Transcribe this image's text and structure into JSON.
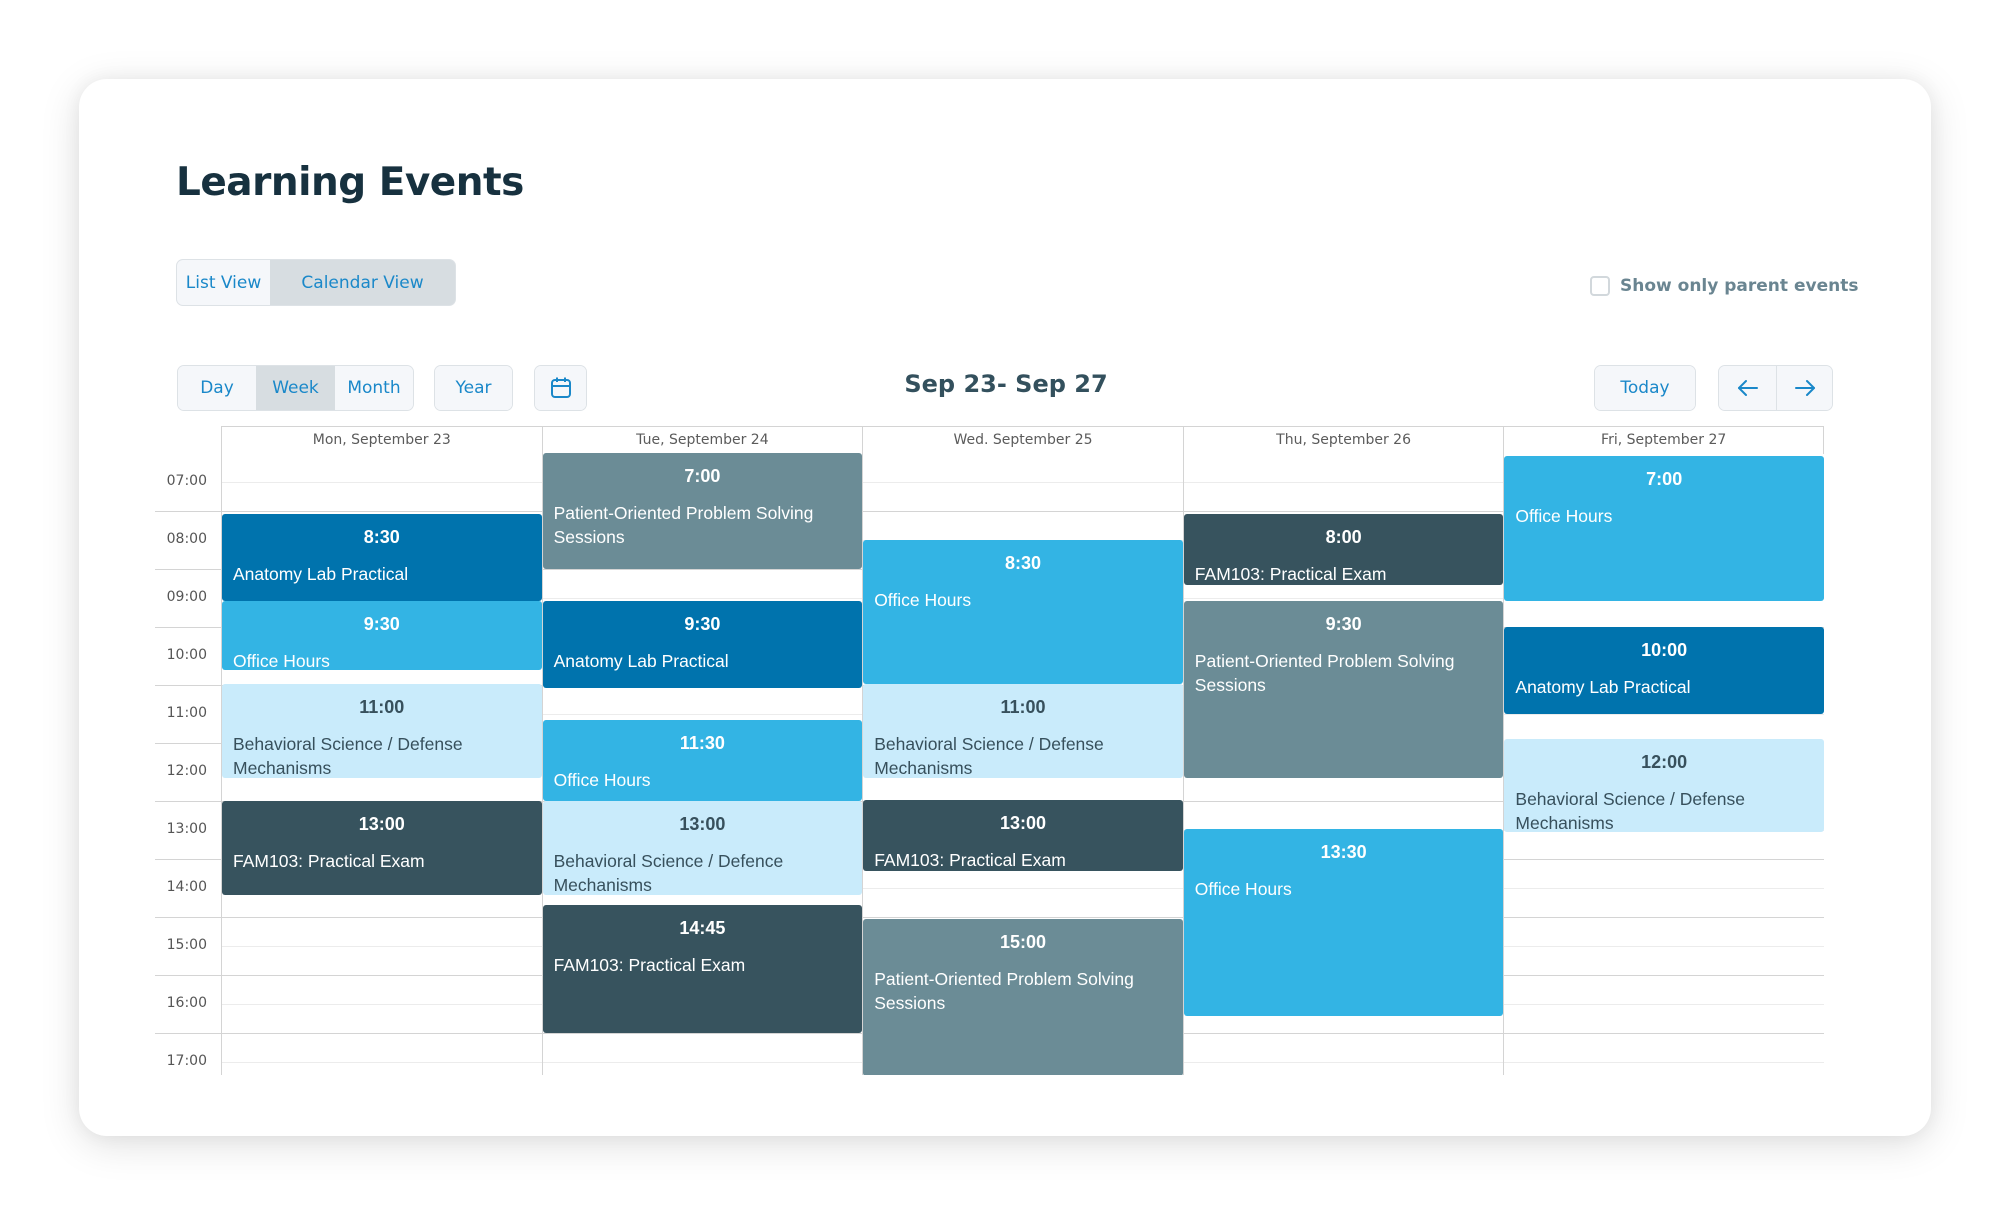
{
  "page": {
    "title": "Learning Events"
  },
  "view_toggle": {
    "options": [
      "List View",
      "Calendar View"
    ],
    "selected": "Calendar View"
  },
  "filters": {
    "parent_events_label": "Show only parent events",
    "parent_events_checked": false
  },
  "toolbar": {
    "views": [
      "Day",
      "Week",
      "Month"
    ],
    "active_view": "Week",
    "year_label": "Year",
    "calendar_icon": "calendar-icon",
    "range_title": "Sep 23- Sep 27",
    "today_label": "Today",
    "prev_icon": "arrow-left-icon",
    "next_icon": "arrow-right-icon"
  },
  "calendar": {
    "days": [
      "Mon, September 23",
      "Tue, September 24",
      "Wed. September 25",
      "Thu, September 26",
      "Fri, September 27"
    ],
    "hours": [
      "07:00",
      "08:00",
      "09:00",
      "10:00",
      "11:00",
      "12:00",
      "13:00",
      "14:00",
      "15:00",
      "16:00",
      "17:00"
    ],
    "event_colors": {
      "anatomy": "#0073ad",
      "office": "#33b4e4",
      "behsci": "#c9ebfb",
      "fam": "#37535e",
      "pops": "#6b8c96"
    },
    "events": [
      {
        "day": 0,
        "time": "8:30",
        "title": "Anatomy Lab Practical",
        "type": "anatomy",
        "start": 8.05,
        "end": 9.55
      },
      {
        "day": 0,
        "time": "9:30",
        "title": "Office Hours",
        "type": "office",
        "start": 9.55,
        "end": 10.75
      },
      {
        "day": 0,
        "time": "11:00",
        "title": "Behavioral Science / Defense Mechanisms",
        "type": "behsci",
        "start": 10.98,
        "end": 12.6
      },
      {
        "day": 0,
        "time": "13:00",
        "title": "FAM103: Practical Exam",
        "type": "fam",
        "start": 13.0,
        "end": 14.62
      },
      {
        "day": 1,
        "time": "7:00",
        "title": "Patient-Oriented Problem Solving Sessions",
        "type": "pops",
        "start": 7.0,
        "end": 9.0
      },
      {
        "day": 1,
        "time": "9:30",
        "title": "Anatomy Lab Practical",
        "type": "anatomy",
        "start": 9.55,
        "end": 11.05
      },
      {
        "day": 1,
        "time": "11:30",
        "title": "Office Hours",
        "type": "office",
        "start": 11.6,
        "end": 13.0
      },
      {
        "day": 1,
        "time": "13:00",
        "title": "Behavioral Science / Defence Mechanisms",
        "type": "behsci",
        "start": 13.0,
        "end": 14.62
      },
      {
        "day": 1,
        "time": "14:45",
        "title": "FAM103: Practical Exam",
        "type": "fam",
        "start": 14.8,
        "end": 17.0
      },
      {
        "day": 2,
        "time": "8:30",
        "title": "Office Hours",
        "type": "office",
        "start": 8.5,
        "end": 10.98
      },
      {
        "day": 2,
        "time": "11:00",
        "title": "Behavioral Science / Defense Mechanisms",
        "type": "behsci",
        "start": 10.98,
        "end": 12.6
      },
      {
        "day": 2,
        "time": "13:00",
        "title": "FAM103: Practical Exam",
        "type": "fam",
        "start": 12.98,
        "end": 14.2
      },
      {
        "day": 2,
        "time": "15:00",
        "title": "Patient-Oriented Problem Solving Sessions",
        "type": "pops",
        "start": 15.03,
        "end": 17.75
      },
      {
        "day": 3,
        "time": "8:00",
        "title": "FAM103: Practical Exam",
        "type": "fam",
        "start": 8.05,
        "end": 9.27
      },
      {
        "day": 3,
        "time": "9:30",
        "title": "Patient-Oriented Problem Solving Sessions",
        "type": "pops",
        "start": 9.55,
        "end": 12.6
      },
      {
        "day": 3,
        "time": "13:30",
        "title": "Office Hours",
        "type": "office",
        "start": 13.48,
        "end": 16.7
      },
      {
        "day": 4,
        "time": "7:00",
        "title": "Office Hours",
        "type": "office",
        "start": 7.05,
        "end": 9.55
      },
      {
        "day": 4,
        "time": "10:00",
        "title": "Anatomy Lab Practical",
        "type": "anatomy",
        "start": 10.0,
        "end": 11.5
      },
      {
        "day": 4,
        "time": "12:00",
        "title": "Behavioral Science / Defense Mechanisms",
        "type": "behsci",
        "start": 11.93,
        "end": 13.54
      }
    ]
  }
}
